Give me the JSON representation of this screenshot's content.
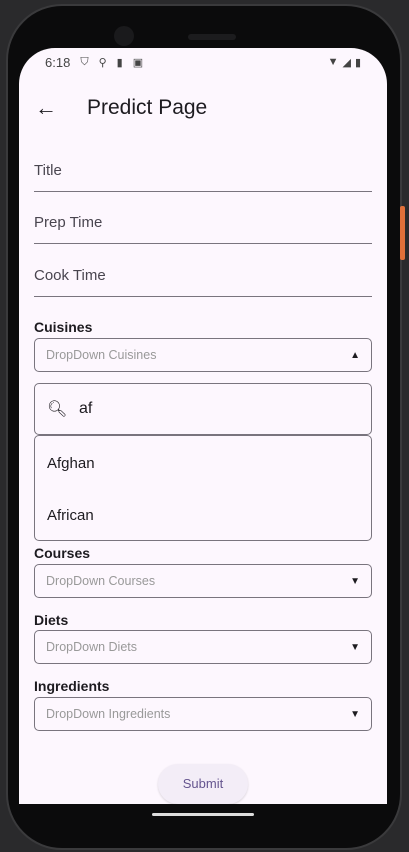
{
  "status": {
    "time": "6:18"
  },
  "appbar": {
    "title": "Predict Page"
  },
  "fields": {
    "title": "Title",
    "prep_time": "Prep Time",
    "cook_time": "Cook Time"
  },
  "cuisines": {
    "label": "Cuisines",
    "placeholder": "DropDown Cuisines",
    "search_value": "af",
    "options": [
      "Afghan",
      "African"
    ]
  },
  "courses": {
    "label": "Courses",
    "placeholder": "DropDown Courses"
  },
  "diets": {
    "label": "Diets",
    "placeholder": "DropDown Diets"
  },
  "ingredients": {
    "label": "Ingredients",
    "placeholder": "DropDown Ingredients"
  },
  "submit_label": "Submit"
}
